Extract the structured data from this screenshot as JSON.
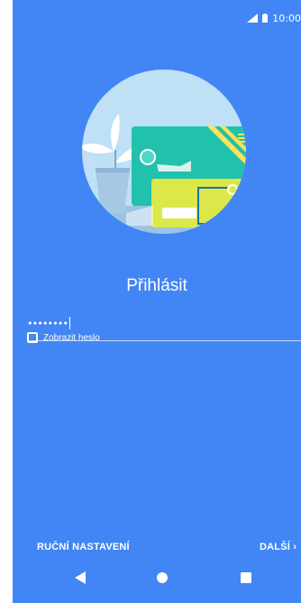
{
  "status_bar": {
    "time": "10:00",
    "icons": [
      "signal-icon",
      "battery-icon"
    ]
  },
  "hero": {
    "illustration": "plant-and-cards-illustration"
  },
  "title": "Přihlásit",
  "password_field": {
    "value": "••••••••"
  },
  "show_password": {
    "label": "Zobrazit heslo",
    "checked": false
  },
  "actions": {
    "manual_label": "RUČNÍ NASTAVENÍ",
    "next_label": "DALŠÍ"
  },
  "navigation": {
    "icons": [
      "back-icon",
      "home-icon",
      "recent-apps-icon"
    ]
  },
  "colors": {
    "background": "#4285f4",
    "circle": "#bfe0f5",
    "accent": "#e91e63"
  }
}
